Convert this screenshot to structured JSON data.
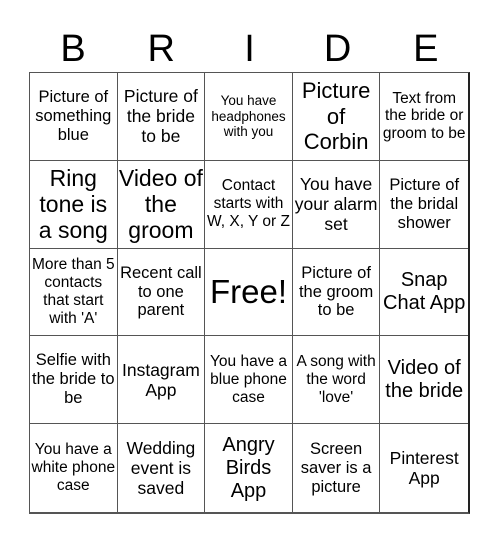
{
  "header": {
    "letters": [
      "B",
      "R",
      "I",
      "D",
      "E"
    ]
  },
  "card": {
    "cells": [
      "Picture of something blue",
      "Picture of the bride to be",
      "You have headphones with you",
      "Picture of Corbin",
      "Text from the bride or groom to be",
      "Ring tone is a song",
      "Video of the groom",
      "Contact starts with W, X, Y or Z",
      "You have your alarm set",
      "Picture of the bridal shower",
      "More than 5 contacts that start with 'A'",
      "Recent call to one parent",
      "Free!",
      "Picture of the groom to be",
      "Snap Chat App",
      "Selfie with the bride to be",
      "Instagram App",
      "You have a blue phone case",
      "A song with the word 'love'",
      "Video of the bride",
      "You have a white phone case",
      "Wedding event is saved",
      "Angry Birds App",
      "Screen saver is a picture",
      "Pinterest App"
    ]
  }
}
